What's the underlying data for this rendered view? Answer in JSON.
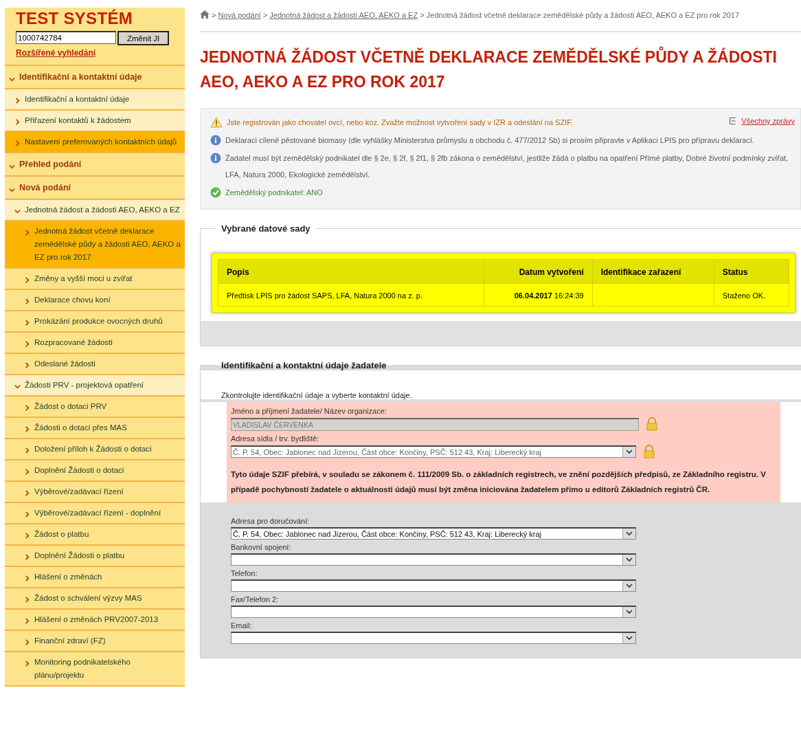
{
  "sidebar": {
    "title": "TEST SYSTÉM",
    "search": {
      "value": "1000742784",
      "button": "Změnit JI"
    },
    "advanced_link": "Rozšířené vyhledání",
    "items": [
      {
        "label": "Identifikační a kontaktní údaje",
        "expanded": true,
        "children": [
          {
            "label": "Identifikační a kontaktní údaje",
            "selected": false,
            "highlighted": true
          },
          {
            "label": "Přiřazení kontaktů k žádostem",
            "selected": false,
            "highlighted": true
          },
          {
            "label": "Nastavení preferovaných kontaktních údajů",
            "selected": true,
            "highlighted": false
          }
        ]
      },
      {
        "label": "Přehled podání",
        "expanded": true
      },
      {
        "label": "Nová podání",
        "expanded": true,
        "children": [
          {
            "label": "Jednotná žádost a žádosti AEO, AEKO a EZ",
            "selected": false,
            "highlighted": true,
            "expanded": true,
            "children": [
              {
                "label": "Jednotná žádost včetně deklarace zemědělské půdy a žádosti AEO, AEKO a EZ pro rok 2017",
                "selected": true,
                "highlighted": false
              },
              {
                "label": "Změny a vyšší moci u zvířat",
                "selected": false,
                "highlighted": false
              },
              {
                "label": "Deklarace chovu koní",
                "selected": false,
                "highlighted": false
              },
              {
                "label": "Prokázání produkce ovocných druhů",
                "selected": false,
                "highlighted": false
              },
              {
                "label": "Rozpracované žádosti",
                "selected": false,
                "highlighted": false
              },
              {
                "label": "Odeslané žádosti",
                "selected": false,
                "highlighted": false
              }
            ]
          },
          {
            "label": "Žádosti PRV - projektová opatření",
            "selected": false,
            "highlighted": true,
            "expanded": true,
            "children": [
              {
                "label": "Žádost o dotaci PRV",
                "selected": false,
                "highlighted": false
              },
              {
                "label": "Žádosti o dotaci přes MAS",
                "selected": false,
                "highlighted": false
              },
              {
                "label": "Doložení příloh k Žádosti o dotaci",
                "selected": false,
                "highlighted": false
              },
              {
                "label": "Doplnění Žádosti o dotaci",
                "selected": false,
                "highlighted": false
              },
              {
                "label": "Výběrové/zadávací řízení",
                "selected": false,
                "highlighted": false
              },
              {
                "label": "Výběrové/zadávací řízení - doplnění",
                "selected": false,
                "highlighted": false
              },
              {
                "label": "Žádost o platbu",
                "selected": false,
                "highlighted": false
              },
              {
                "label": "Doplnění Žádosti o platbu",
                "selected": false,
                "highlighted": false
              },
              {
                "label": "Hlášení o změnách",
                "selected": false,
                "highlighted": false
              },
              {
                "label": "Žádost o schválení výzvy MAS",
                "selected": false,
                "highlighted": false
              },
              {
                "label": "Hlášení o změnách PRV2007-2013",
                "selected": false,
                "highlighted": false
              },
              {
                "label": "Finanční zdraví (FZ)",
                "selected": false,
                "highlighted": false
              },
              {
                "label": "Monitoring podnikatelského plánu/projektu",
                "selected": false,
                "highlighted": false
              }
            ]
          }
        ]
      }
    ]
  },
  "breadcrumb": {
    "separator": ">",
    "links": [
      "Nová podání",
      "Jednotná žádost a žádosti AEO, AEKO a EZ"
    ],
    "current": "Jednotná žádost včetně deklarace zemědělské půdy a žádosti AEO, AEKO a EZ pro rok 2017"
  },
  "title": "JEDNOTNÁ ŽÁDOST VČETNĚ DEKLARACE ZEMĚDĚLSKÉ PŮDY A ŽÁDOSTI AEO, AEKO A EZ PRO ROK 2017",
  "messages": {
    "all_link": "Všechny zprávy",
    "items": [
      {
        "kind": "warning",
        "text": "Jste registrován jako chovatel ovcí, nebo koz. Zvažte možnost vytvoření sady v IZR a odeslání na SZIF."
      },
      {
        "kind": "info",
        "text": "Deklaraci cíleně pěstované biomasy (dle vyhlášky Ministerstva průmyslu a obchodu č. 477/2012 Sb) si prosím připravte v Aplikaci LPIS pro přípravu deklarací."
      },
      {
        "kind": "info",
        "text": "Žadatel musí být zemědělský podnikatel dle § 2e, § 2f, § 2f1, § 2fb zákona o zemědělství, jestliže žádá o platbu na opatření Přímé platby, Dobré životní podmínky zvířat, LFA, Natura 2000, Ekologické zemědělství."
      },
      {
        "kind": "success",
        "text": "Zemědělský podnikatel: ANO"
      }
    ]
  },
  "datasets": {
    "legend": "Vybrané datové sady",
    "columns": [
      "Popis",
      "Datum vytvoření",
      "Identifikace zařazení",
      "Status"
    ],
    "rows": [
      [
        "Předtisk LPIS pro žádost SAPS, LFA, Natura 2000 na z. p.",
        "**06.04.2017** 16:24:39",
        "",
        "Staženo OK."
      ]
    ]
  },
  "applicant": {
    "legend": "Identifikační a kontaktní údaje žadatele",
    "intro": "Zkontrolujte identifikační údaje a vyberte kontaktní údaje.",
    "registry_fields": [
      {
        "kind": "input",
        "label": "Jméno a příjmení žadatele/ Název organizace:",
        "value": "VLADISLAV ČERVENKA",
        "locked": true
      },
      {
        "kind": "select",
        "label": "Adresa sídla / trv. bydliště:",
        "value": "Č. P. 54, Obec: Jablonec nad Jizerou, Část obce: Končiny, PSČ: 512 43, Kraj: Liberecký kraj",
        "locked": true
      }
    ],
    "registry_note": "Tyto údaje SZIF přebírá, v souladu se zákonem č. 111/2009 Sb. o základních registrech, ve znění pozdějších předpisů, ze Základního registru. V případě pochybností žadatele o aktuálnosti údajů musí být změna iniciována žadatelem přímo u editorů Základních registrů ČR.",
    "contact_fields": [
      {
        "kind": "select",
        "label": "Adresa pro doručování:",
        "value": "Č. P. 54, Obec: Jablonec nad Jizerou, Část obce: Končiny, PSČ: 512 43, Kraj: Liberecký kraj"
      },
      {
        "kind": "select",
        "label": "Bankovní spojení:"
      },
      {
        "kind": "select",
        "label": "Telefon:"
      },
      {
        "kind": "select",
        "label": "Fax/Telefon 2:"
      },
      {
        "kind": "select",
        "label": "Email:"
      }
    ]
  }
}
